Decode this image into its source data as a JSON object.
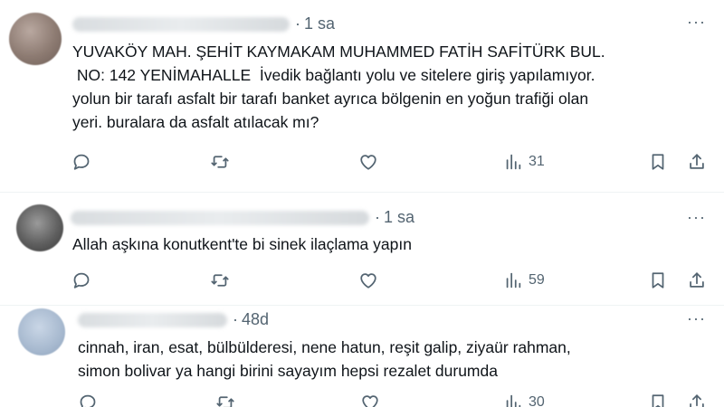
{
  "tweets": [
    {
      "time": "1 sa",
      "more": "···",
      "text": "YUVAKÖY MAH. ŞEHİT KAYMAKAM MUHAMMED FATİH SAFİTÜRK BUL.\n NO: 142 YENİMAHALLE  İvedik bağlantı yolu ve sitelere giriş yapılamıyor.\nyolun bir tarafı asfalt bir tarafı banket ayrıca bölgenin en yoğun trafiği olan\nyeri. buralara da asfalt atılacak mı?",
      "views": "31"
    },
    {
      "time": "1 sa",
      "more": "···",
      "text": "Allah aşkına konutkent'te bi sinek ilaçlama yapın",
      "views": "59"
    },
    {
      "time": "48d",
      "more": "···",
      "text": "cinnah, iran, esat, bülbülderesi, nene hatun, reşit galip, ziyaür rahman,\nsimon bolivar ya hangi birini sayayım hepsi rezalet durumda",
      "views": "30"
    }
  ],
  "icons": {
    "reply": "reply-icon",
    "repost": "repost-icon",
    "like": "like-icon",
    "views": "views-icon",
    "bookmark": "bookmark-icon",
    "share": "share-icon",
    "more": "more-icon"
  }
}
